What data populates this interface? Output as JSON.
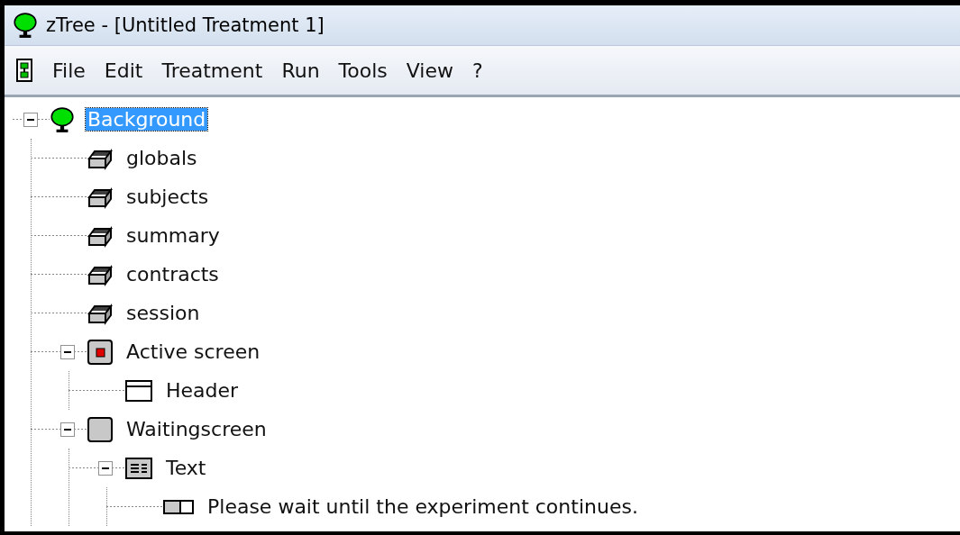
{
  "window": {
    "title": "zTree - [Untitled Treatment 1]"
  },
  "menu": [
    "File",
    "Edit",
    "Treatment",
    "Run",
    "Tools",
    "View",
    "?"
  ],
  "tree": [
    {
      "label": "Background",
      "kind": "tree",
      "selected": true,
      "expanded": true,
      "children": [
        {
          "label": "globals",
          "kind": "table",
          "selected": false
        },
        {
          "label": "subjects",
          "kind": "table",
          "selected": false
        },
        {
          "label": "summary",
          "kind": "table",
          "selected": false
        },
        {
          "label": "contracts",
          "kind": "table",
          "selected": false
        },
        {
          "label": "session",
          "kind": "table",
          "selected": false
        },
        {
          "label": "Active screen",
          "kind": "active-screen",
          "selected": false,
          "expanded": true,
          "children": [
            {
              "label": "Header",
              "kind": "header",
              "selected": false
            }
          ]
        },
        {
          "label": "Waitingscreen",
          "kind": "screen",
          "selected": false,
          "expanded": true,
          "children": [
            {
              "label": "Text",
              "kind": "text",
              "selected": false,
              "expanded": true,
              "children": [
                {
                  "label": "Please wait until the experiment continues.",
                  "kind": "item",
                  "selected": false
                }
              ]
            }
          ]
        }
      ]
    }
  ]
}
